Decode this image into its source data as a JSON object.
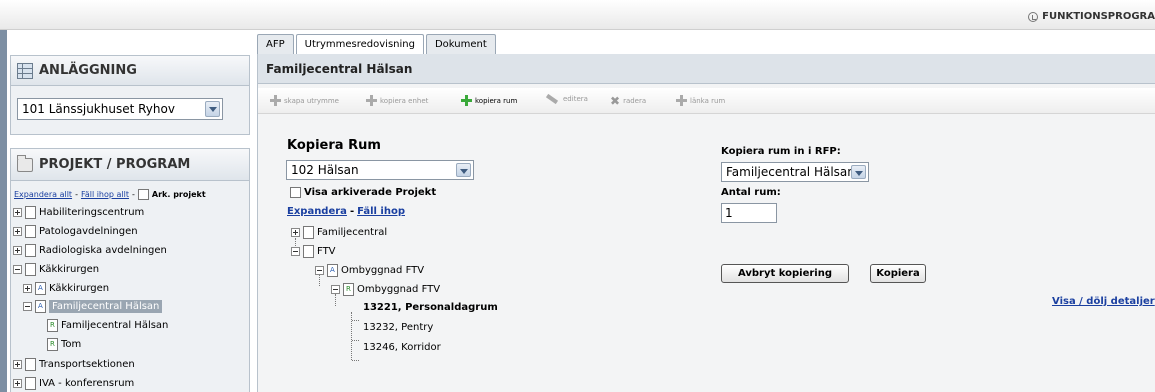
{
  "header": {
    "banner_label": "FUNKTIONSPROGRA"
  },
  "sidebar": {
    "anlaggning": {
      "title": "ANLÄGGNING",
      "selected": "101 Länssjukhuset Ryhov"
    },
    "projekt": {
      "title": "PROJEKT / PROGRAM",
      "expand_all": "Expandera allt",
      "collapse_all": "Fäll ihop allt",
      "separator": "-",
      "ark_label": "Ark. projekt",
      "tree": [
        {
          "label": "Habiliteringscentrum"
        },
        {
          "label": "Patologavdelningen"
        },
        {
          "label": "Radiologiska avdelningen"
        },
        {
          "label": "Käkkirurgen"
        },
        {
          "label": "Käkkirurgen"
        },
        {
          "label": "Familjecentral Hälsan"
        },
        {
          "label": "Familjecentral Hälsan"
        },
        {
          "label": "Tom"
        },
        {
          "label": "Transportsektionen"
        },
        {
          "label": "IVA - konferensrum"
        }
      ]
    }
  },
  "tabs": [
    {
      "label": "AFP"
    },
    {
      "label": "Utrymmesredovisning"
    },
    {
      "label": "Dokument"
    }
  ],
  "main": {
    "title": "Familjecentral Hälsan",
    "toolbar": [
      {
        "label": "skapa utrymme"
      },
      {
        "label": "kopiera enhet"
      },
      {
        "label": "kopiera rum"
      },
      {
        "label": "editera"
      },
      {
        "label": "radera"
      },
      {
        "label": "länka rum"
      }
    ],
    "form": {
      "heading": "Kopiera Rum",
      "project_select": "102 Hälsan",
      "show_archived": "Visa arkiverade Projekt",
      "expand": "Expandera",
      "collapse": "Fäll ihop",
      "separator": "-",
      "tree": [
        {
          "label": "Familjecentral"
        },
        {
          "label": "FTV"
        },
        {
          "label": "Ombyggnad FTV"
        },
        {
          "label": "Ombyggnad FTV"
        },
        {
          "label": "13221, Personaldagrum"
        },
        {
          "label": "13232, Pentry"
        },
        {
          "label": "13246, Korridor"
        }
      ],
      "target_label": "Kopiera rum in i RFP:",
      "target_select": "Familjecentral Hälsan",
      "count_label": "Antal rum:",
      "count_value": "1",
      "cancel_button": "Avbryt kopiering",
      "copy_button": "Kopiera",
      "details_link": "Visa / dölj detaljer"
    }
  }
}
